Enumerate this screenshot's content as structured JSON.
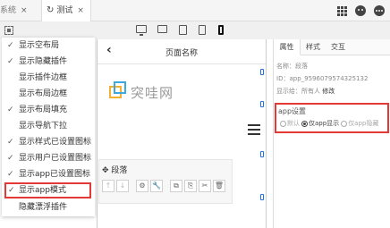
{
  "tabs": [
    {
      "label": "系统",
      "close": "×"
    },
    {
      "label": "测试",
      "close": "×",
      "icon": "refresh-icon"
    }
  ],
  "top_icons": [
    "apps-grid-icon",
    "user-avatar-icon",
    "more-icon"
  ],
  "device_icons": [
    "desktop-icon",
    "laptop-icon",
    "tablet-icon",
    "tablet-portrait-icon",
    "phone-icon"
  ],
  "phone": {
    "back": "‹",
    "title": "页面名称",
    "logo_text": "突哇网"
  },
  "menu": {
    "items": [
      {
        "label": "显示空布局",
        "checked": true
      },
      {
        "label": "显示隐藏插件",
        "checked": true
      },
      {
        "label": "显示插件边框",
        "checked": false
      },
      {
        "label": "显示布局边框",
        "checked": false
      },
      {
        "label": "显示布局填充",
        "checked": true
      },
      {
        "label": "显示导航下拉",
        "checked": false
      },
      {
        "label": "显示样式已设置图标",
        "checked": true
      },
      {
        "label": "显示用户已设置图标",
        "checked": true
      },
      {
        "label": "显示app已设置图标",
        "checked": true
      },
      {
        "label": "显示app模式",
        "checked": true
      },
      {
        "label": "隐藏漂浮插件",
        "checked": false
      }
    ],
    "check_char": "✓"
  },
  "paragraph": {
    "icon": "✥",
    "title": "段落",
    "tools": [
      "↑",
      "↓",
      "⚙",
      "🔧",
      "⧉",
      "⎘",
      "✂",
      "🗑"
    ]
  },
  "right_panel": {
    "tabs": [
      "属性",
      "样式",
      "交互"
    ],
    "name_label": "名称：",
    "name_value": "段落",
    "id_label": "ID：",
    "id_value": "app_9596079574325132",
    "display_label": "显示给：",
    "display_value": "所有人",
    "modify": "修改",
    "app_title": "app设置",
    "options": [
      "默认",
      "仅app显示",
      "仅app隐藏"
    ],
    "selected_option": "仅app显示"
  },
  "colors": {
    "highlight_red": "#e53935",
    "phone_marker_blue": "#1a73e8",
    "logo_orange": "#f2b133",
    "logo_blue": "#3da8e0"
  }
}
